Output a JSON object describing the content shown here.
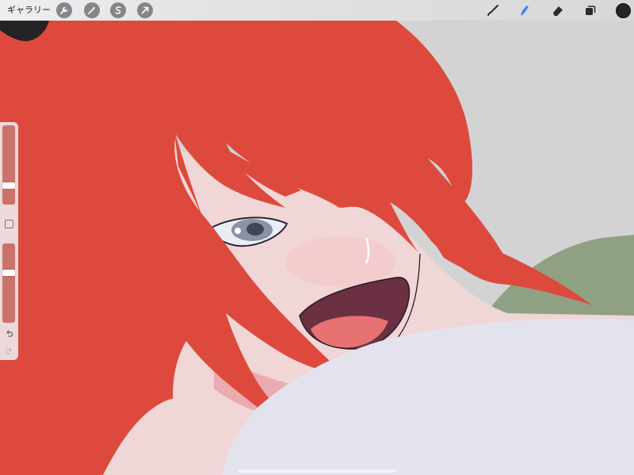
{
  "toolbar": {
    "gallery_label": "ギャラリー",
    "actions_icon": "wrench-icon",
    "adjustments_icon": "magic-wand-icon",
    "selection_icon": "selection-s-icon",
    "transform_icon": "arrow-cursor-icon",
    "brush_icon": "brush-icon",
    "smudge_icon": "smudge-finger-icon",
    "eraser_icon": "eraser-icon",
    "layers_icon": "layers-icon",
    "active_tool": "smudge",
    "active_color": "#252528",
    "accent_color": "#3b82f6"
  },
  "sidebar": {
    "brush_size": 0.22,
    "opacity": 0.64,
    "undo_icon": "undo-arrow-icon",
    "redo_icon": "redo-arrow-icon"
  },
  "canvas": {
    "hair_color": "#dd4a3d",
    "skin_color": "#f0d6d6",
    "background_color": "#d3d3d3",
    "pillow_color": "#e3e3ee",
    "shirt_color": "#8fa182"
  }
}
